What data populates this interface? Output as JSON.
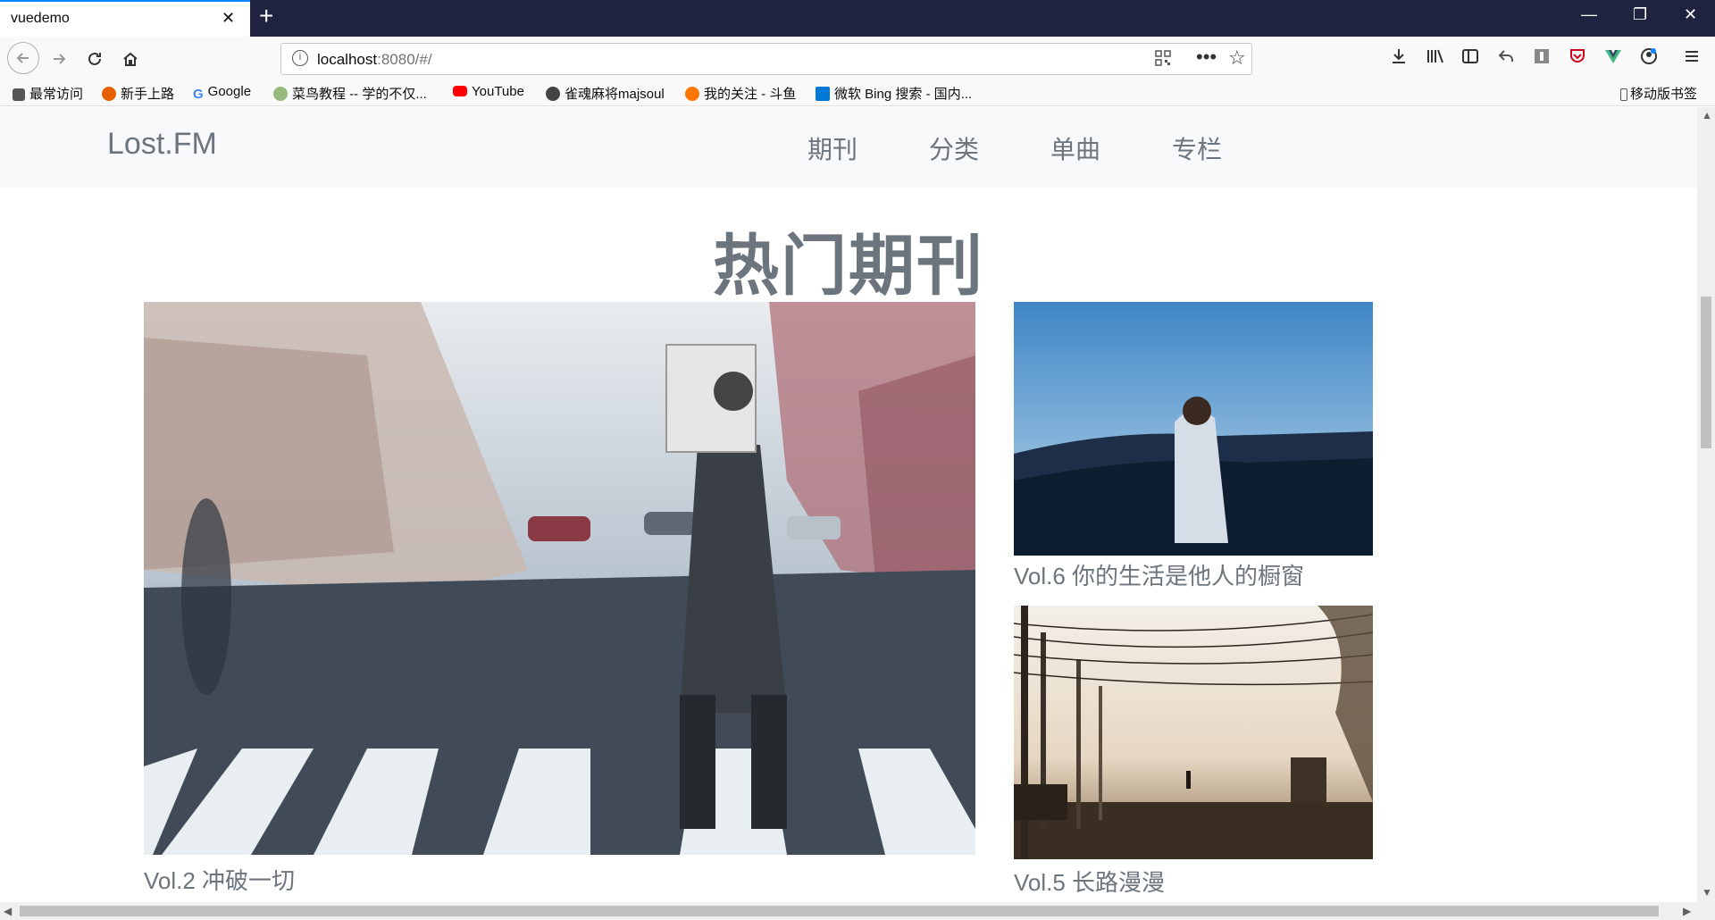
{
  "browser": {
    "tab_title": "vuedemo",
    "tab_close": "✕",
    "new_tab": "+",
    "window_controls": {
      "minimize": "—",
      "restore": "❐",
      "close": "✕"
    },
    "url_host": "localhost",
    "url_rest": ":8080/#/",
    "url_icons": [
      "qr-code-icon",
      "page-actions-icon",
      "bookmark-star-icon"
    ],
    "toolbar_icons": [
      "download-icon",
      "library-icon",
      "sidebar-icon",
      "undo-icon",
      "extension-icon",
      "pocket-icon",
      "vue-devtools-icon",
      "account-icon",
      "menu-icon"
    ],
    "bookmarks": [
      {
        "label": "最常访问",
        "icon": "gear-icon",
        "color": "#555555"
      },
      {
        "label": "新手上路",
        "icon": "firefox-icon",
        "color": "#e66000"
      },
      {
        "label": "Google",
        "icon": "google-icon",
        "color": "#4285f4"
      },
      {
        "label": "菜鸟教程 -- 学的不仅...",
        "icon": "runoob-icon",
        "color": "#96b97d"
      },
      {
        "label": "YouTube",
        "icon": "youtube-icon",
        "color": "#ff0000"
      },
      {
        "label": "雀魂麻将majsoul",
        "icon": "majsoul-icon",
        "color": "#444444"
      },
      {
        "label": "我的关注 - 斗鱼",
        "icon": "douyu-icon",
        "color": "#ff7700"
      },
      {
        "label": "微软 Bing 搜索 - 国内...",
        "icon": "bing-icon",
        "color": "#0078d7"
      }
    ],
    "mobile_bookmarks": "移动版书签"
  },
  "site": {
    "brand": "Lost.FM",
    "menu": [
      "期刊",
      "分类",
      "单曲",
      "专栏"
    ],
    "section_title": "热门期刊",
    "cards": [
      {
        "caption": "Vol.2 冲破一切",
        "image": "woman-crosswalk-photo"
      },
      {
        "caption": "Vol.6 你的生活是他人的橱窗",
        "image": "mountain-man-photo"
      },
      {
        "caption": "Vol.5 长路漫漫",
        "image": "power-lines-street-photo"
      }
    ]
  }
}
